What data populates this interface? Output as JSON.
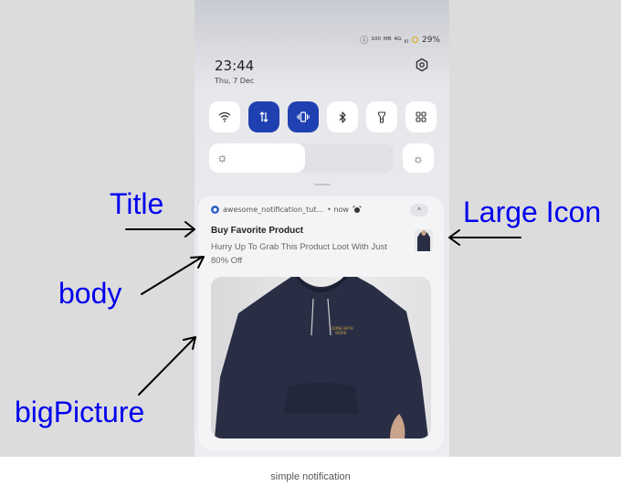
{
  "status": {
    "icons_text": "ⓘ ¹⁰⁰ ᴹᴮ ⁴ᴳ ᵢₗₗ",
    "battery": "29%"
  },
  "panel": {
    "time": "23:44",
    "date": "Thu, 7 Dec"
  },
  "tiles": [
    {
      "icon": "wifi-icon",
      "on": false
    },
    {
      "icon": "mobile-data-icon",
      "on": true
    },
    {
      "icon": "vibrate-icon",
      "on": true
    },
    {
      "icon": "bluetooth-icon",
      "on": false
    },
    {
      "icon": "flashlight-icon",
      "on": false
    },
    {
      "icon": "grid-icon",
      "on": false
    }
  ],
  "brightness": {
    "level": 0.52
  },
  "notification": {
    "app": "awesome_notification_tut...",
    "meta": "• now",
    "title": "Buy Favorite Product",
    "body": "Hurry Up To Grab This Product Loot With Just 80% Off",
    "hoodie_text": "DONE WITH\nWORK"
  },
  "annotations": {
    "title": "Title",
    "body": "body",
    "bigpicture": "bigPicture",
    "largeicon": "Large Icon"
  },
  "caption": "simple notification",
  "colors": {
    "annotation": "#0000ee",
    "tile_active": "#1f40b0",
    "hoodie": "#2a2e45"
  }
}
